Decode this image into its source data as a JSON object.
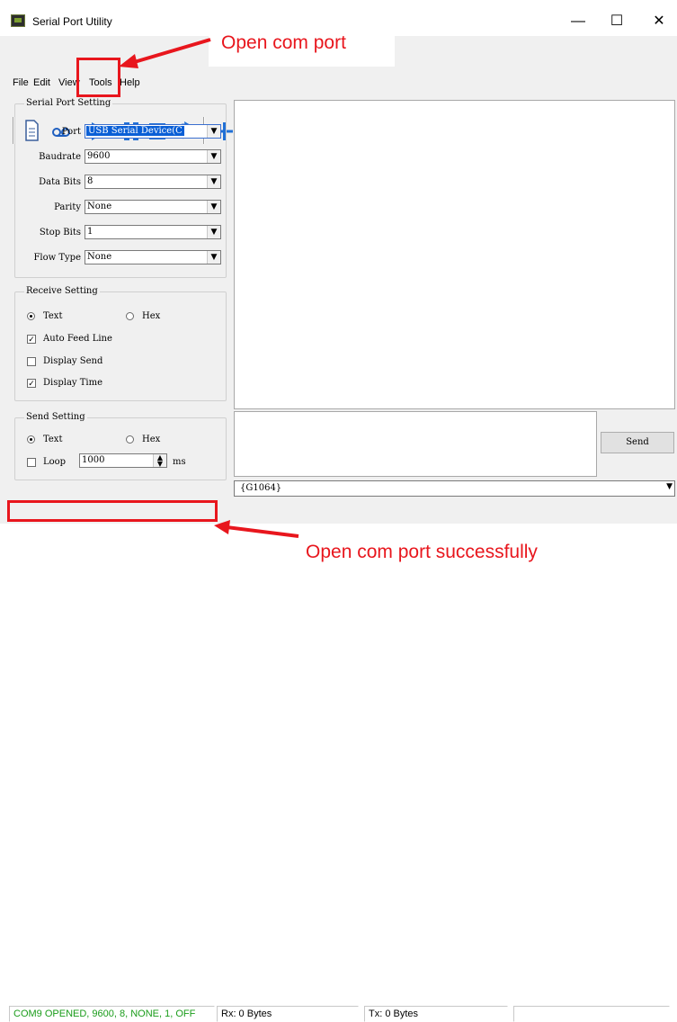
{
  "window": {
    "title": "Serial Port Utility",
    "controls": {
      "minimize": "—",
      "maximize": "☐",
      "close": "✕"
    }
  },
  "menu": [
    "File",
    "Edit",
    "View",
    "Tools",
    "Help"
  ],
  "toolbar": {
    "buttons": [
      "new-file",
      "loop",
      "play",
      "pause",
      "stop",
      "refresh",
      "add",
      "remove",
      "panel",
      "settings"
    ]
  },
  "serial_setting": {
    "title": "Serial Port Setting",
    "port": {
      "label": "Port",
      "value": "USB Serial Device(C"
    },
    "baudrate": {
      "label": "Baudrate",
      "value": "9600"
    },
    "data_bits": {
      "label": "Data Bits",
      "value": "8"
    },
    "parity": {
      "label": "Parity",
      "value": "None"
    },
    "stop_bits": {
      "label": "Stop Bits",
      "value": "1"
    },
    "flow_type": {
      "label": "Flow Type",
      "value": "None"
    }
  },
  "receive_setting": {
    "title": "Receive Setting",
    "text_label": "Text",
    "text_selected": true,
    "hex_label": "Hex",
    "hex_selected": false,
    "auto_feed_line": {
      "label": "Auto Feed Line",
      "checked": true
    },
    "display_send": {
      "label": "Display Send",
      "checked": false
    },
    "display_time": {
      "label": "Display Time",
      "checked": true
    }
  },
  "send_setting": {
    "title": "Send Setting",
    "text_label": "Text",
    "text_selected": true,
    "hex_label": "Hex",
    "hex_selected": false,
    "loop": {
      "label": "Loop",
      "checked": false
    },
    "interval_value": "1000",
    "interval_unit": "ms"
  },
  "send_button": "Send",
  "command_combo": "{G1064}",
  "status_bar": {
    "port_status": "COM9 OPENED, 9600, 8, NONE, 1, OFF",
    "port_status_color": "#1a9c1a",
    "rx": "Rx: 0 Bytes",
    "tx": "Tx: 0 Bytes"
  },
  "annotations": {
    "open_port": "Open com port",
    "open_success": "Open com port successfully",
    "color": "#e8161d"
  }
}
